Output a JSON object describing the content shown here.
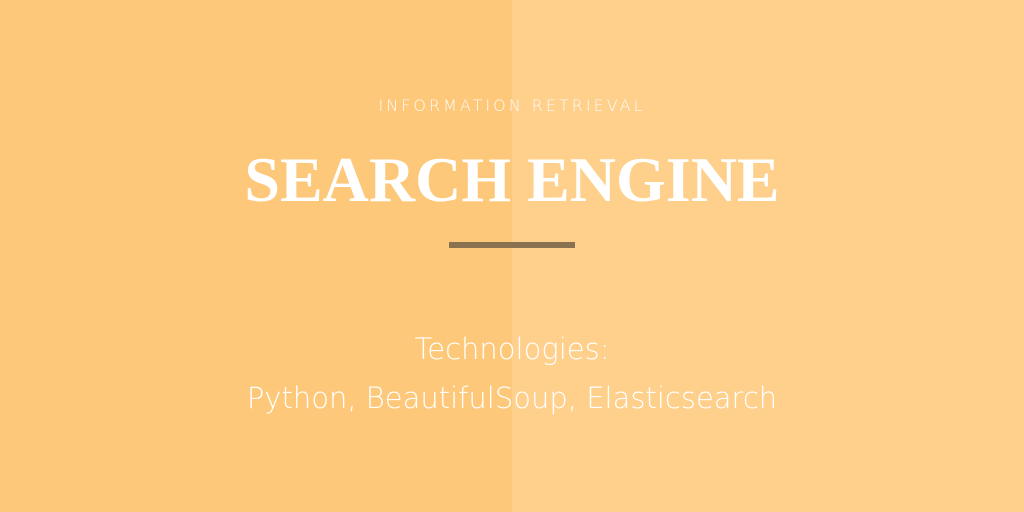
{
  "colors": {
    "left_panel": "#fec87a",
    "right_panel": "#fed08c",
    "divider": "#8a7250",
    "text": "#ffffff"
  },
  "eyebrow": "INFORMATION RETRIEVAL",
  "title": "SEARCH ENGINE",
  "technologies": {
    "label": "Technologies:",
    "list": "Python, BeautifulSoup, Elasticsearch"
  }
}
